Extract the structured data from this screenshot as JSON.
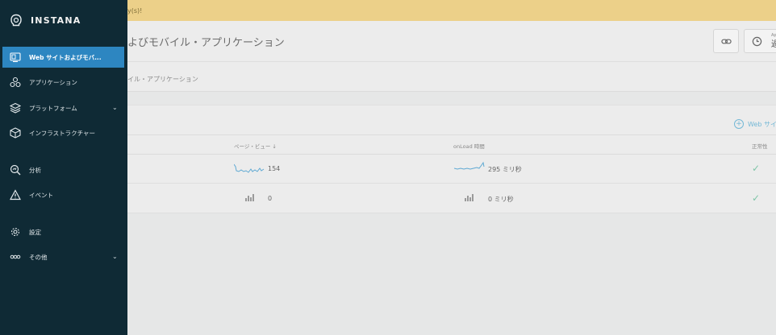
{
  "banner": {
    "text": "y(s)!"
  },
  "header": {
    "title": "よびモバイル・アプリケーション",
    "time_small": "Ap",
    "time_big": "過"
  },
  "breadcrumb": "イル・アプリケーション",
  "panel": {
    "add_label": "Web サイ"
  },
  "table": {
    "headers": {
      "page_views": "ページ・ビュー ↓",
      "onload": "onLoad 時間",
      "health": "正常性"
    },
    "rows": [
      {
        "page_views": "154",
        "onload": "295 ミリ秒"
      },
      {
        "page_views": "0",
        "onload": "0 ミリ秒"
      }
    ]
  },
  "sidebar": {
    "brand": "INSTANA",
    "items": [
      {
        "label": "Web サイトおよびモバ...",
        "icon": "web-monitor-icon"
      },
      {
        "label": "アプリケーション",
        "icon": "applications-icon"
      },
      {
        "label": "プラットフォーム",
        "icon": "platforms-icon"
      },
      {
        "label": "インフラストラクチャー",
        "icon": "infrastructure-icon"
      },
      {
        "label": "分析",
        "icon": "analyze-icon"
      },
      {
        "label": "イベント",
        "icon": "events-icon"
      },
      {
        "label": "設定",
        "icon": "gear-icon"
      },
      {
        "label": "その他",
        "icon": "more-icon"
      }
    ]
  },
  "colors": {
    "sidebar": "#0f2a35",
    "active": "#2d86c1",
    "banner": "#ecd089"
  }
}
